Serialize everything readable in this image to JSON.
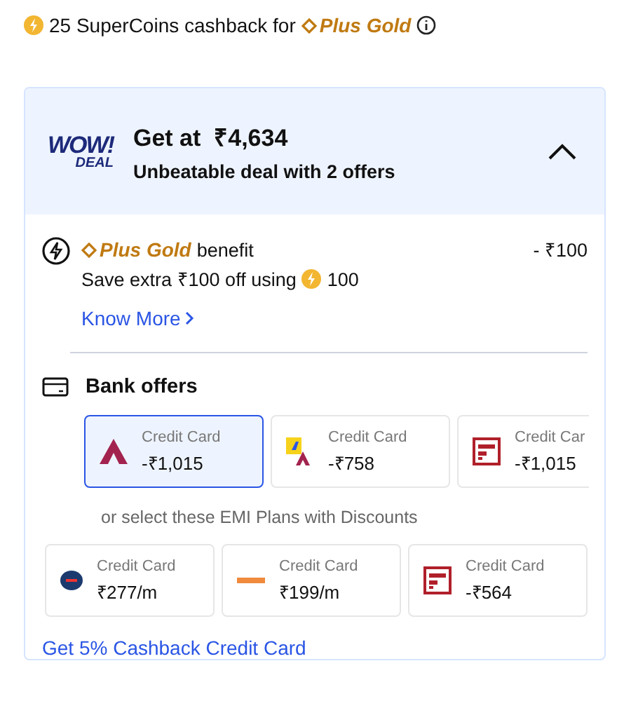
{
  "supercoins": {
    "text": "25 SuperCoins cashback for",
    "brand": "Plus Gold"
  },
  "deal": {
    "badge_top": "WOW!",
    "badge_bottom": "DEAL",
    "title": "Get at  ₹4,634",
    "subtitle": "Unbeatable deal with 2 offers",
    "expanded": true
  },
  "benefit": {
    "brand": "Plus Gold",
    "label": "benefit",
    "amount": "- ₹100",
    "detail": "Save extra ₹100 off using",
    "coins": "100",
    "link": "Know More"
  },
  "bank_offers": {
    "title": "Bank offers",
    "cards": [
      {
        "kind": "axis",
        "label": "Credit Card",
        "value": "-₹1,015",
        "selected": true
      },
      {
        "kind": "flipkart-axis",
        "label": "Credit Card",
        "value": "-₹758",
        "selected": false
      },
      {
        "kind": "red-bank",
        "label": "Credit Car",
        "value": "-₹1,015",
        "selected": false
      }
    ]
  },
  "emi": {
    "title": "or select these EMI Plans with Discounts",
    "cards": [
      {
        "kind": "blue-bank",
        "label": "Credit Card",
        "value": "₹277/m",
        "selected": false
      },
      {
        "kind": "orange-bank",
        "label": "Credit Card",
        "value": "₹199/m",
        "selected": false
      },
      {
        "kind": "red-bank",
        "label": "Credit Card",
        "value": "-₹564",
        "selected": false
      }
    ]
  },
  "footer_link": "Get 5% Cashback Credit Card"
}
